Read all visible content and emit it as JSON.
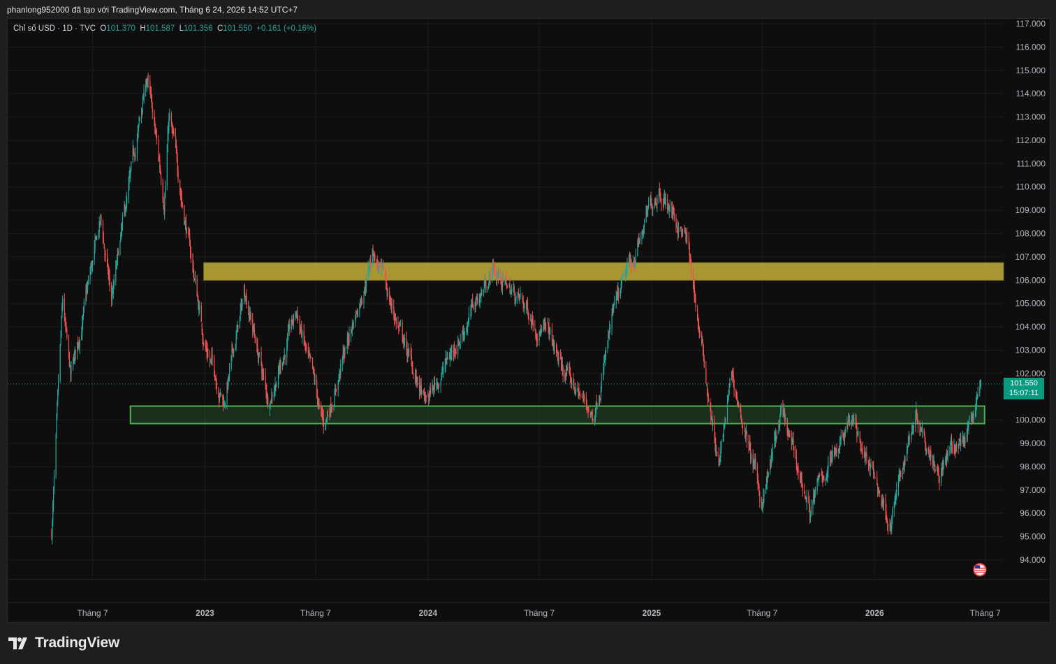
{
  "header": {
    "attribution": "phanlong952000 đã tạo với TradingView.com, Tháng 6 24, 2026 14:52 UTC+7"
  },
  "legend": {
    "symbol": "Chỉ số USD · 1D · TVC",
    "o_label": "O",
    "o_value": "101.370",
    "h_label": "H",
    "h_value": "101.587",
    "l_label": "L",
    "l_value": "101.356",
    "c_label": "C",
    "c_value": "101.550",
    "change": "+0.161 (+0.16%)"
  },
  "price_tag": {
    "price": "101.550",
    "countdown": "15:07:11"
  },
  "footer": {
    "brand": "TradingView"
  },
  "icons": {
    "logo": "tradingview-logo-icon",
    "flag": "us-flag-icon"
  },
  "colors": {
    "up": "#26a69a",
    "down": "#ef5350",
    "background": "#0e0e0f",
    "resistance_zone": "#c9b53a",
    "support_zone": "#4caf50"
  },
  "chart_data": {
    "type": "candlestick",
    "symbol": "Chỉ số USD",
    "timeframe": "1D",
    "y_axis": {
      "ticks": [
        "117.000",
        "116.000",
        "115.000",
        "114.000",
        "113.000",
        "112.000",
        "111.000",
        "110.000",
        "109.000",
        "108.000",
        "107.000",
        "106.000",
        "105.000",
        "104.000",
        "103.000",
        "102.000",
        "100.000",
        "99.000",
        "98.000",
        "97.000",
        "96.000",
        "95.000",
        "94.000"
      ],
      "ylim": [
        93.2,
        117.2
      ]
    },
    "x_axis": {
      "ticks": [
        "Tháng 7",
        "2023",
        "Tháng 7",
        "2024",
        "Tháng 7",
        "2025",
        "Tháng 7",
        "2026",
        "Tháng 7"
      ]
    },
    "price_path": [
      [
        "2022-04-25",
        95.2
      ],
      [
        "2022-05-13",
        104.8
      ],
      [
        "2022-05-26",
        101.6
      ],
      [
        "2022-07-14",
        108.5
      ],
      [
        "2022-08-01",
        105.1
      ],
      [
        "2022-09-28",
        114.7
      ],
      [
        "2022-10-26",
        109.5
      ],
      [
        "2022-11-03",
        113.1
      ],
      [
        "2022-12-30",
        103.5
      ],
      [
        "2023-02-01",
        100.8
      ],
      [
        "2023-03-08",
        105.6
      ],
      [
        "2023-04-14",
        100.8
      ],
      [
        "2023-05-31",
        104.6
      ],
      [
        "2023-07-14",
        99.6
      ],
      [
        "2023-10-03",
        107.3
      ],
      [
        "2023-12-27",
        100.6
      ],
      [
        "2024-04-16",
        106.5
      ],
      [
        "2024-07-17",
        103.6
      ],
      [
        "2024-08-05",
        102.3
      ],
      [
        "2024-09-27",
        100.2
      ],
      [
        "2024-10-31",
        104.5
      ],
      [
        "2025-01-13",
        110.1
      ],
      [
        "2025-02-28",
        107.6
      ],
      [
        "2025-04-21",
        97.9
      ],
      [
        "2025-05-12",
        101.9
      ],
      [
        "2025-07-01",
        96.4
      ],
      [
        "2025-08-01",
        100.2
      ],
      [
        "2025-09-17",
        96.2
      ],
      [
        "2025-11-21",
        100.3
      ],
      [
        "2026-01-27",
        95.6
      ],
      [
        "2026-03-09",
        100.5
      ],
      [
        "2026-04-17",
        97.9
      ],
      [
        "2026-05-29",
        99.3
      ],
      [
        "2026-06-24",
        101.55
      ]
    ],
    "last_close": 101.55,
    "zones": [
      {
        "name": "resistance",
        "from": "2022-12-30",
        "to": "2026-07-31",
        "low": 106.0,
        "high": 106.75
      },
      {
        "name": "support",
        "from": "2022-09-01",
        "to": "2026-06-30",
        "low": 99.85,
        "high": 100.6
      }
    ],
    "grid": true,
    "price_axis_side": "right"
  }
}
